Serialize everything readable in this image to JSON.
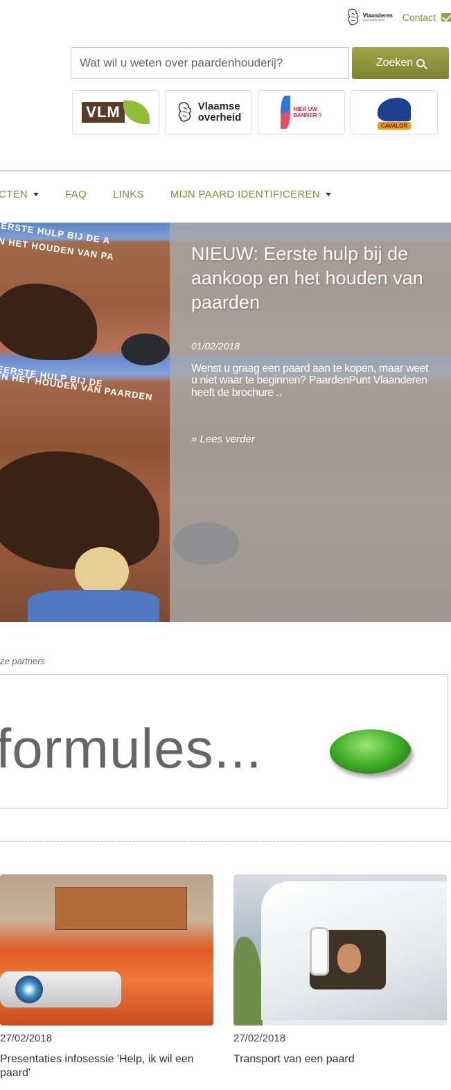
{
  "topbar": {
    "vlaanderen_logo_main": "Vlaanderen",
    "vlaanderen_logo_sub": "verbeelding werkt",
    "contact_label": "Contact",
    "icons": [
      "lion-icon",
      "mail-icon"
    ]
  },
  "search": {
    "placeholder": "Wat wil u weten over paardenhouderij?",
    "value": "",
    "button_label": "Zoeken"
  },
  "partner_logos": [
    {
      "name": "VLM",
      "text": "VLM"
    },
    {
      "name": "Vlaamse overheid",
      "text_1": "Vlaamse",
      "text_2": "overheid"
    },
    {
      "name": "Hier uw banner",
      "text_1": "HIER UW",
      "text_2": "BANNER ?"
    },
    {
      "name": "Cavalor",
      "text": "CAVALOR"
    }
  ],
  "nav": {
    "items": [
      {
        "label": "CTEN",
        "dropdown": true
      },
      {
        "label": "FAQ",
        "dropdown": false
      },
      {
        "label": "LINKS",
        "dropdown": false
      },
      {
        "label": "MIJN PAARD IDENTIFICEREN",
        "dropdown": true
      }
    ]
  },
  "hero": {
    "banner_text_1": "EERSTE HULP BIJ DE A",
    "banner_text_2": "EN HET HOUDEN VAN PA",
    "banner_text_3": "EERSTE HULP BIJ DE",
    "banner_text_4": "EN HET HOUDEN VAN PAARDEN",
    "title": "NIEUW: Eerste hulp bij de aankoop en het houden van paarden",
    "date": "01/02/2018",
    "excerpt": "Wenst u graag een paard aan te kopen, maar weet u niet waar te beginnen? PaardenPunt Vlaanderen heeft de brochure ..",
    "read_more": "» Lees verder"
  },
  "partners": {
    "label": "ze partners",
    "banner_text": "formules..."
  },
  "news": [
    {
      "date": "27/02/2018",
      "title": "Presentaties infosessie 'Help, ik wil een paard'"
    },
    {
      "date": "27/02/2018",
      "title": "Transport van een paard"
    }
  ],
  "colors": {
    "accent_green": "#6f9a3b",
    "button_olive": "#8a8e3a",
    "overlay_gray": "#aaaaaa"
  }
}
